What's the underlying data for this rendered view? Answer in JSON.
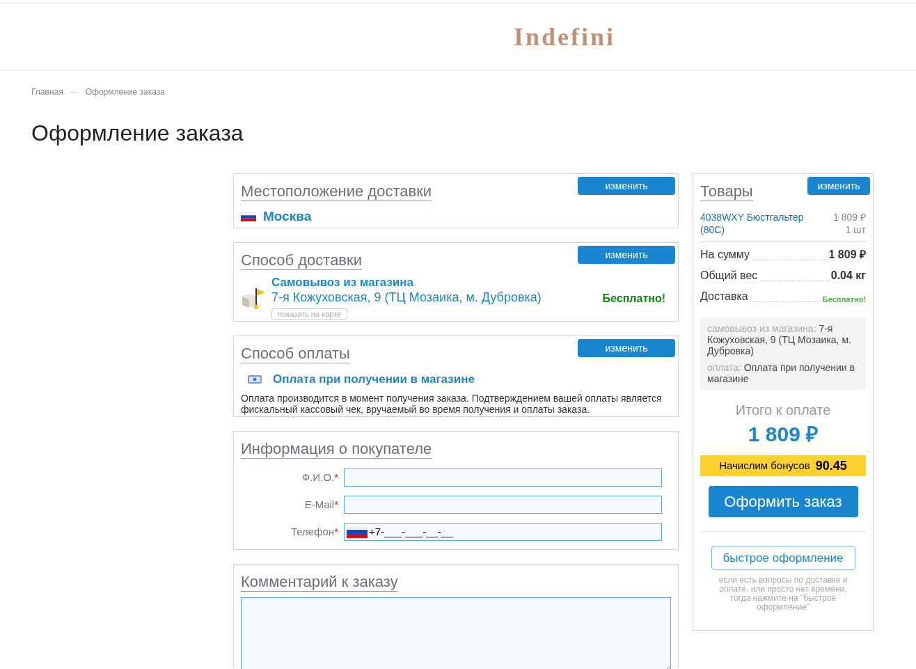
{
  "logo": "Indefini",
  "breadcrumbs": [
    {
      "label": "Главная"
    },
    {
      "label": "Оформление заказа"
    }
  ],
  "breadcrumb_separator": "—",
  "page_title": "Оформление заказа",
  "location": {
    "title": "Местоположение доставки",
    "button": "изменить",
    "city": "Москва"
  },
  "delivery": {
    "title": "Способ доставки",
    "button": "изменить",
    "name": "Самовывоз из магазина",
    "address": "7-я Кожуховская, 9 (ТЦ Мозаика, м. Дубровка)",
    "map_link": "показать на карте",
    "price": "Бесплатно!"
  },
  "payment": {
    "title": "Способ оплаты",
    "button": "изменить",
    "name": "Оплата при получении в магазине",
    "description": "Оплата производится в момент получения заказа. Подтверждением вашей оплаты является фискальный кассовый чек, вручаемый во время получения и оплаты заказа."
  },
  "buyer": {
    "title": "Информация о покупателе",
    "required_mark": "*",
    "fields": [
      {
        "label": "Ф.И.О.",
        "required": true,
        "kind": "text"
      },
      {
        "label": "E-Mail",
        "required": true,
        "kind": "text"
      },
      {
        "label": "Телефон",
        "required": true,
        "kind": "phone",
        "value": "+7-___-___-__-__"
      }
    ]
  },
  "comment": {
    "title": "Комментарий к заказу"
  },
  "summary": {
    "title": "Товары",
    "button": "изменить",
    "items": [
      {
        "name": "4038WXY Бюстгальтер (80C)",
        "price": "1 809 ₽",
        "qty": "1 шт"
      }
    ],
    "totals": [
      {
        "label": "На сумму",
        "value": "1 809 ₽",
        "kind": "bold"
      },
      {
        "label": "Общий вес",
        "value": "0.04 кг",
        "kind": "bold"
      },
      {
        "label": "Доставка",
        "value": "Бесплатно!",
        "kind": "free"
      }
    ],
    "notes": [
      {
        "label": "самовывоз из магазина:",
        "value": "7-я Кожуховская, 9 (ТЦ Мозаика, м. Дубровка)"
      },
      {
        "label": "оплата:",
        "value": "Оплата при получении в магазине"
      }
    ],
    "total_label": "Итого к оплате",
    "total_value": "1 809 ₽",
    "bonus": {
      "label": "Начислим бонусов",
      "value": "90.45"
    },
    "submit": "Оформить заказ",
    "quick_button": "быстрое оформление",
    "quick_note": "если есть вопросы по доставке и оплате, или просто нет времени, тогда нажмите на \"быстрое оформление\""
  }
}
